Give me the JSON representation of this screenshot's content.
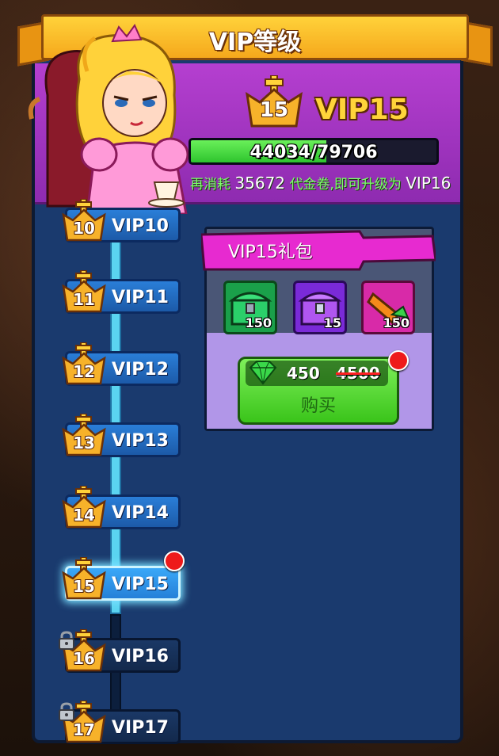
{
  "title": "VIP等级",
  "current": {
    "level": "15",
    "label": "VIP15",
    "progress_text": "44034/79706",
    "progress_value": 44034,
    "progress_max": 79706,
    "hint_prefix": "再消耗",
    "hint_amount": "35672",
    "hint_middle": "代金卷,即可升级为",
    "hint_next": "VIP16"
  },
  "vip_levels": [
    {
      "num": "10",
      "label": "VIP10",
      "state": "unlocked"
    },
    {
      "num": "11",
      "label": "VIP11",
      "state": "unlocked"
    },
    {
      "num": "12",
      "label": "VIP12",
      "state": "unlocked"
    },
    {
      "num": "13",
      "label": "VIP13",
      "state": "unlocked"
    },
    {
      "num": "14",
      "label": "VIP14",
      "state": "unlocked"
    },
    {
      "num": "15",
      "label": "VIP15",
      "state": "active"
    },
    {
      "num": "16",
      "label": "VIP16",
      "state": "locked"
    },
    {
      "num": "17",
      "label": "VIP17",
      "state": "locked"
    }
  ],
  "gift": {
    "title": "VIP15礼包",
    "items": [
      {
        "icon": "green-chest-icon",
        "count": "150"
      },
      {
        "icon": "purple-chest-icon",
        "count": "15"
      },
      {
        "icon": "orange-scroll-icon",
        "count": "150"
      }
    ],
    "price_icon": "green-gem-icon",
    "price": "450",
    "original_price": "4500",
    "buy_label": "购买"
  },
  "colors": {
    "banner": "#ffc82a",
    "header": "#a035c4",
    "panel": "#1a3a6e",
    "progress": "#3ed23e",
    "tab": "#e72ad0"
  }
}
